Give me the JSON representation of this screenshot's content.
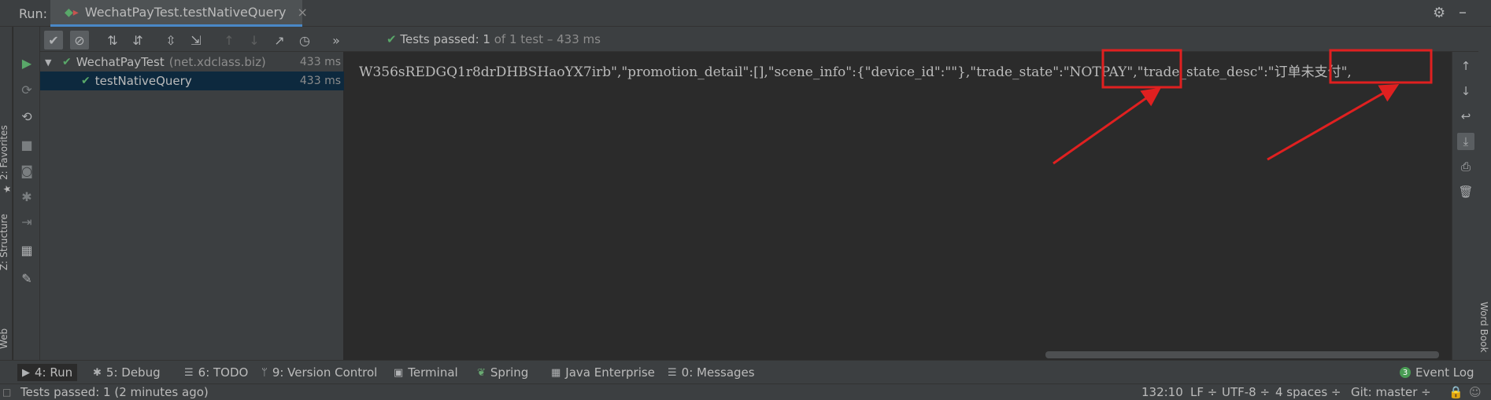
{
  "header": {
    "run_label": "Run:",
    "tab_title": "WechatPayTest.testNativeQuery",
    "close_glyph": "×"
  },
  "left_edge": {
    "favorites": "2: Favorites",
    "structure": "Z: Structure",
    "web": "Web"
  },
  "right_edge": {
    "word_book": "Word Book"
  },
  "toolbar": {
    "status_prefix": "Tests passed:",
    "status_count": "1",
    "status_suffix": "of 1 test – 433 ms",
    "more": "»"
  },
  "tree": {
    "root": {
      "name": "WechatPayTest",
      "package": "(net.xdclass.biz)",
      "time": "433 ms"
    },
    "child": {
      "name": "testNativeQuery",
      "time": "433 ms"
    }
  },
  "console": {
    "line": "W356sREDGQ1r8drDHBSHaoYX7irb\",\"promotion_detail\":[],\"scene_info\":{\"device_id\":\"\"},\"trade_state\":\"NOTPAY\",\"trade_state_desc\":\"订单未支付\","
  },
  "annotation_color": "#e02020",
  "tool_windows": [
    {
      "label": "4: Run",
      "icon": "play-icon"
    },
    {
      "label": "5: Debug",
      "icon": "bug-icon"
    },
    {
      "label": "6: TODO",
      "icon": "list-icon"
    },
    {
      "label": "9: Version Control",
      "icon": "vcs-icon"
    },
    {
      "label": "Terminal",
      "icon": "terminal-icon"
    },
    {
      "label": "Spring",
      "icon": "spring-icon"
    },
    {
      "label": "Java Enterprise",
      "icon": "grid-icon"
    },
    {
      "label": "0: Messages",
      "icon": "messages-icon"
    }
  ],
  "event_log": {
    "label": "Event Log",
    "count": "3"
  },
  "status_bar": {
    "message": "Tests passed: 1 (2 minutes ago)",
    "position": "132:10",
    "line_sep": "LF ÷",
    "encoding": "UTF-8 ÷",
    "indent": "4 spaces ÷",
    "git": "Git: master ÷"
  },
  "colors": {
    "accent": "#4a88c7",
    "passed": "#59a869",
    "selection": "#0d293e"
  }
}
